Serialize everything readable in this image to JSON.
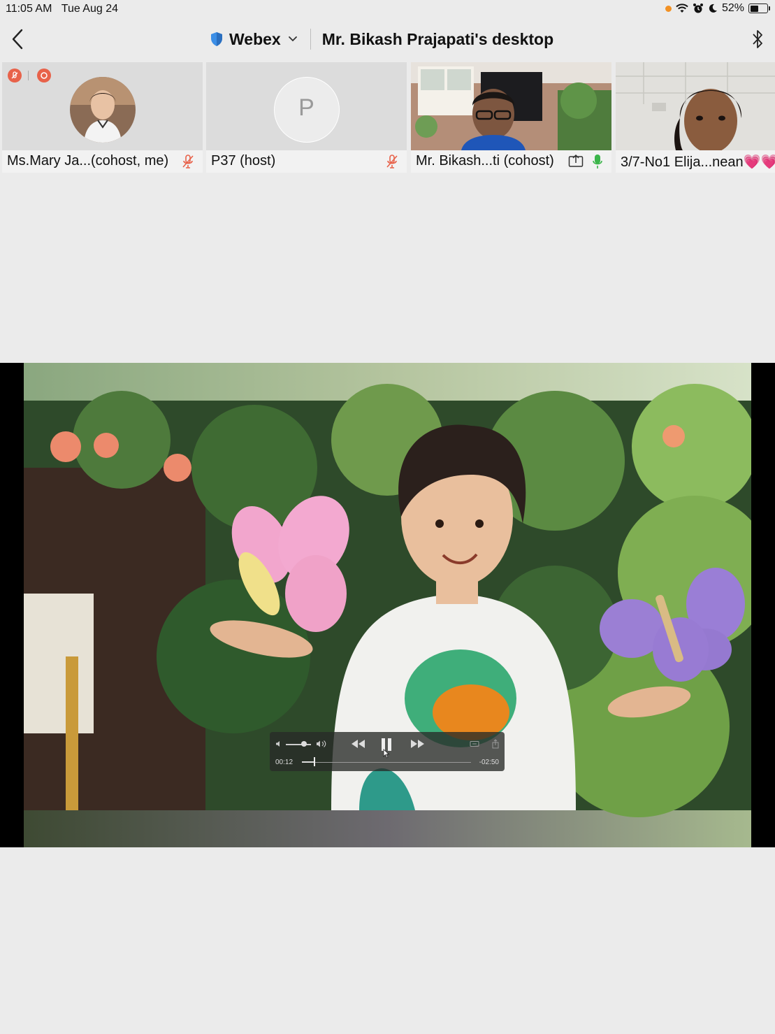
{
  "status_bar": {
    "time": "11:05 AM",
    "date": "Tue Aug 24",
    "battery": "52%",
    "battery_level": 0.52
  },
  "nav": {
    "app_name": "Webex",
    "title": "Mr. Bikash Prajapati's desktop"
  },
  "participants": [
    {
      "label": "Ms.Mary Ja...(cohost, me)",
      "muted": true
    },
    {
      "label": "P37 (host)",
      "initial": "P",
      "muted": true
    },
    {
      "label": "Mr. Bikash...ti (cohost)",
      "sharing": true,
      "muted": false
    },
    {
      "label": "3/7-No1 Elija...nean",
      "suffix": "💗💗"
    }
  ],
  "player": {
    "elapsed": "00:12",
    "remaining": "-02:50",
    "progress": 0.07,
    "volume": 0.6
  },
  "colors": {
    "mute_red": "#e8624a",
    "mic_green": "#3bb54a",
    "shield_blue": "#3b8ee6"
  }
}
